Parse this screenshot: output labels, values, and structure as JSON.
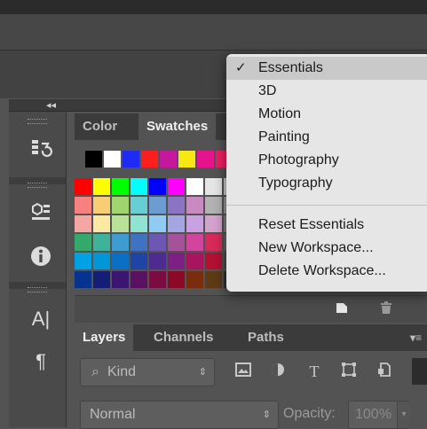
{
  "panel_tabs": [
    "Color",
    "Swatches"
  ],
  "layers_tabs": [
    "Layers",
    "Channels",
    "Paths"
  ],
  "layers_filter": {
    "kind_label": "Kind"
  },
  "blend_mode": "Normal",
  "opacity": {
    "label": "Opacity:",
    "value": "100%"
  },
  "workspace_menu": {
    "checked_item": "Essentials",
    "check_mark": "✓",
    "items": [
      "Essentials",
      "3D",
      "Motion",
      "Painting",
      "Photography",
      "Typography"
    ],
    "actions": [
      "Reset Essentials",
      "New Workspace...",
      "Delete Workspace..."
    ]
  },
  "colors": {
    "accent_menu_bg": "#e6e6e6",
    "panel_bg": "#535353",
    "tab_bar_bg": "#3b3b3b"
  },
  "swatches": {
    "recent": [
      "#000000",
      "#ffffff",
      "#1d2bf5",
      "#ff1e1e",
      "#c6189c",
      "#f7e714",
      "#e6148c",
      "#f01d63"
    ],
    "grid": [
      [
        "#ff0000",
        "#ffff00",
        "#00ff00",
        "#00ffff",
        "#0000ff",
        "#ff00ff",
        "#ffffff",
        "#e5e5e5",
        "#cccccc"
      ],
      [
        "#f7817f",
        "#f9cd74",
        "#9fd46f",
        "#67cfd4",
        "#6d9cd3",
        "#8c74c4",
        "#c88ac0",
        "#b2b2b2",
        "#999999"
      ],
      [
        "#f4a7a2",
        "#fbe9a1",
        "#b9e197",
        "#8fe3d3",
        "#8fcbf2",
        "#a3a6e3",
        "#c7a1e0",
        "#d3a2cd",
        "#808080"
      ],
      [
        "#35a96c",
        "#3fb29a",
        "#3e9cd0",
        "#4072c3",
        "#6c58b3",
        "#a6529b",
        "#d2459d",
        "#d72a58",
        "#666666"
      ],
      [
        "#00a2e4",
        "#0096d7",
        "#0b6fc6",
        "#1e44a6",
        "#4e2b91",
        "#7d1f84",
        "#a8155e",
        "#b31032",
        "#4d4d4d"
      ],
      [
        "#06338d",
        "#151e76",
        "#3a1670",
        "#5b1161",
        "#7b0c42",
        "#8b0827",
        "#7a2d0d",
        "#5e3a16",
        "#333333"
      ]
    ]
  },
  "icons": {
    "toolbar": [
      "history-icon",
      "3d-icon",
      "info-icon",
      "character-icon",
      "paragraph-icon"
    ],
    "panel_bottom": [
      "new-swatch-icon",
      "delete-swatch-icon"
    ],
    "layer_filters": [
      "image-filter-icon",
      "adjustment-filter-icon",
      "type-filter-icon",
      "shape-filter-icon",
      "smart-object-filter-icon"
    ]
  }
}
